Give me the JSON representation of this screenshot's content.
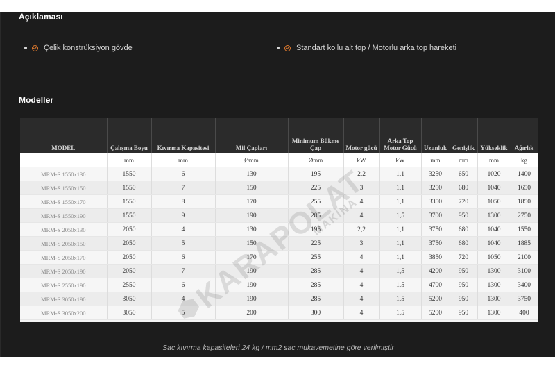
{
  "sections": {
    "description_title": "Açıklaması",
    "models_title": "Modeller"
  },
  "features": [
    "Çelik konstrüksiyon gövde",
    "Standart kollu alt top / Motorlu arka top hareketi"
  ],
  "colors": {
    "accent": "#e07a2e",
    "background": "#1c1c1c",
    "header": "#2b2b2b"
  },
  "table": {
    "headers": [
      "MODEL",
      "Çalışma Boyu",
      "Kıvırma Kapasitesi",
      "Mil Çapları",
      "Minimum Bükme Çap",
      "Motor gücü",
      "Arka Top Motor Gücü",
      "Uzunluk",
      "Genişlik",
      "Yükseklik",
      "Ağırlık"
    ],
    "units": [
      "",
      "mm",
      "mm",
      "Ømm",
      "Ømm",
      "kW",
      "kW",
      "mm",
      "mm",
      "mm",
      "kg"
    ],
    "rows": [
      [
        "MRM-S 1550x130",
        "1550",
        "6",
        "130",
        "195",
        "2,2",
        "1,1",
        "3250",
        "650",
        "1020",
        "1400"
      ],
      [
        "MRM-S 1550x150",
        "1550",
        "7",
        "150",
        "225",
        "3",
        "1,1",
        "3250",
        "680",
        "1040",
        "1650"
      ],
      [
        "MRM-S 1550x170",
        "1550",
        "8",
        "170",
        "255",
        "4",
        "1,1",
        "3350",
        "720",
        "1050",
        "1850"
      ],
      [
        "MRM-S 1550x190",
        "1550",
        "9",
        "190",
        "285",
        "4",
        "1,5",
        "3700",
        "950",
        "1300",
        "2750"
      ],
      [
        "MRM-S 2050x130",
        "2050",
        "4",
        "130",
        "195",
        "2,2",
        "1,1",
        "3750",
        "680",
        "1040",
        "1550"
      ],
      [
        "MRM-S 2050x150",
        "2050",
        "5",
        "150",
        "225",
        "3",
        "1,1",
        "3750",
        "680",
        "1040",
        "1885"
      ],
      [
        "MRM-S 2050x170",
        "2050",
        "6",
        "170",
        "255",
        "4",
        "1,1",
        "3850",
        "720",
        "1050",
        "2100"
      ],
      [
        "MRM-S 2050x190",
        "2050",
        "7",
        "190",
        "285",
        "4",
        "1,5",
        "4200",
        "950",
        "1300",
        "3100"
      ],
      [
        "MRM-S 2550x190",
        "2550",
        "6",
        "190",
        "285",
        "4",
        "1,5",
        "4700",
        "950",
        "1300",
        "3400"
      ],
      [
        "MRM-S 3050x190",
        "3050",
        "4",
        "190",
        "285",
        "4",
        "1,5",
        "5200",
        "950",
        "1300",
        "3750"
      ],
      [
        "MRM-S 3050x200",
        "3050",
        "5",
        "200",
        "300",
        "4",
        "1,5",
        "5200",
        "950",
        "1300",
        "400"
      ]
    ]
  },
  "watermark": {
    "brand": "KARAPOLAT",
    "sub": "MAKİNA"
  },
  "footnote": "Sac kıvırma kapasiteleri 24 kg / mm2 sac mukavemetine göre verilmiştir"
}
